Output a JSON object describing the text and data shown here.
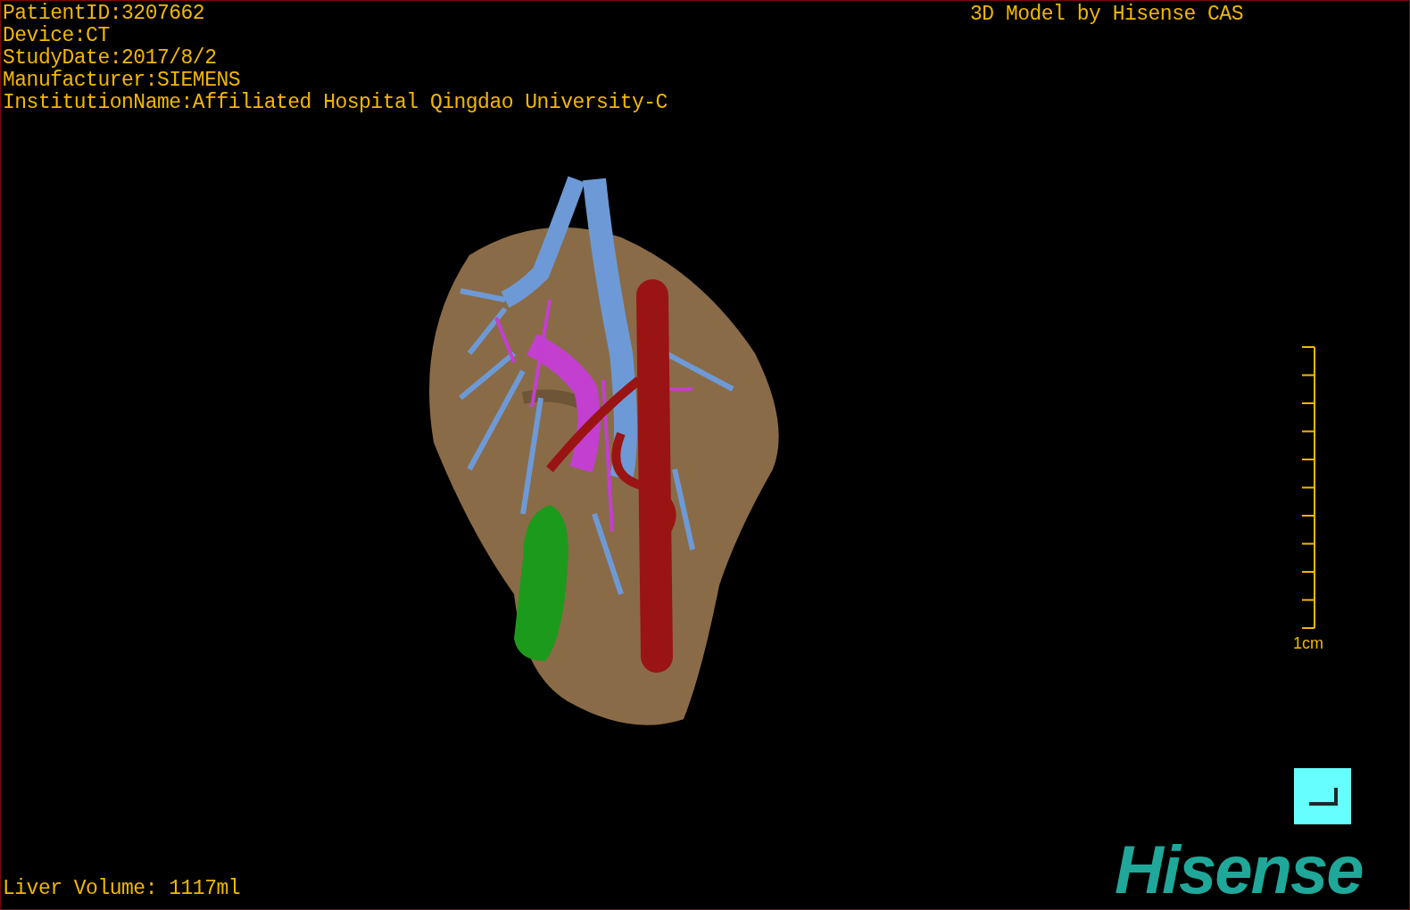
{
  "study_info": [
    "PatientID:3207662",
    "Device:CT",
    "StudyDate:2017/8/2",
    "Manufacturer:SIEMENS",
    "InstitutionName:Affiliated Hospital Qingdao University-C"
  ],
  "credit": "3D Model by Hisense CAS",
  "scale_bar": {
    "label": "1cm"
  },
  "liver_volume": "Liver Volume: 1117ml",
  "logo": "Hisense"
}
